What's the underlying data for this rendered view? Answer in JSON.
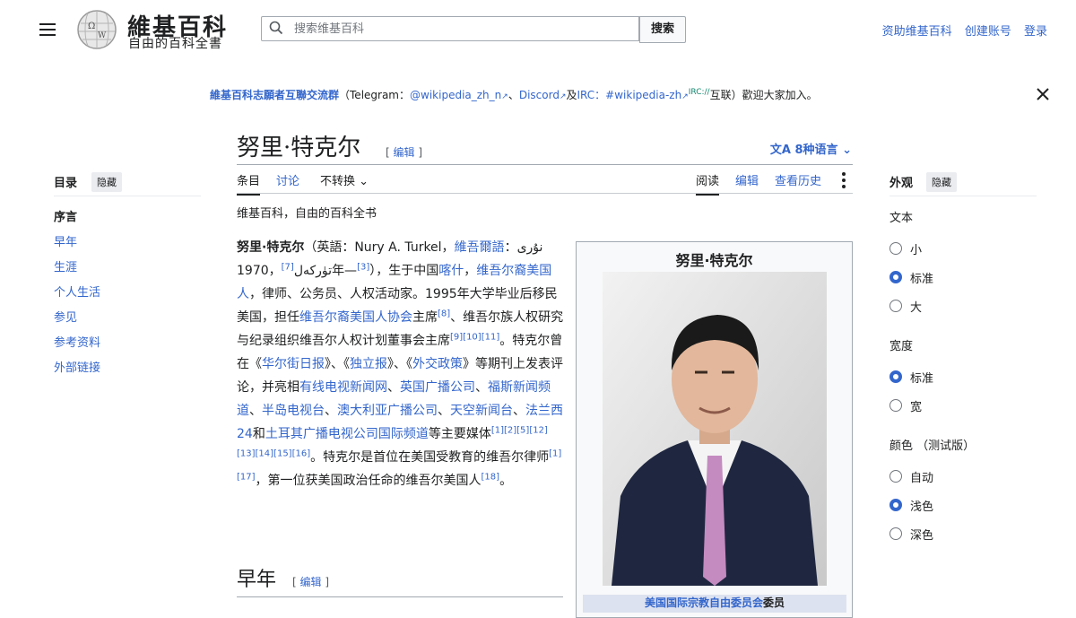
{
  "header": {
    "wordmark": "維基百科",
    "tagline": "自由的百科全書",
    "search_placeholder": "搜索维基百科",
    "search_button": "搜索",
    "links": [
      "资助维基百科",
      "创建账号",
      "登录"
    ]
  },
  "banner": {
    "title": "維基百科志願者互聯交流群",
    "p1": "（Telegram：",
    "telegram": "@wikipedia_zh_n",
    "sep": "、",
    "discord": "Discord",
    "and": "及",
    "irc": "IRC：",
    "irc_channel": "#wikipedia-zh",
    "irc_sup": "IRC://",
    "tail": "互联）歡迎大家加入。"
  },
  "article": {
    "title": "努里·特克尔",
    "edit": "编辑",
    "languages": "8种语言",
    "tabs_left": [
      "条目",
      "讨论",
      "不转换"
    ],
    "tabs_right": [
      "阅读",
      "编辑",
      "查看历史"
    ],
    "subtitle": "维基百科，自由的百科全书",
    "section": "早年"
  },
  "toc": {
    "title": "目录",
    "hide": "隐藏",
    "items": [
      "序言",
      "早年",
      "生涯",
      "个人生活",
      "参见",
      "参考资料",
      "外部链接"
    ]
  },
  "infobox": {
    "title": "努里·特克尔",
    "caption_link": "美国国际宗教自由委员会",
    "caption_tail": "委员"
  },
  "appearance": {
    "title": "外观",
    "hide": "隐藏",
    "groups": [
      {
        "label": "文本",
        "options": [
          "小",
          "标准",
          "大"
        ],
        "selected": 1
      },
      {
        "label": "宽度",
        "options": [
          "标准",
          "宽"
        ],
        "selected": 0
      },
      {
        "label": "颜色 （测试版）",
        "options": [
          "自动",
          "浅色",
          "深色"
        ],
        "selected": 1
      }
    ]
  },
  "body": {
    "b1": "努里·特克尔",
    "t1": "（英語：Nury A. Turkel，",
    "l1": "維吾爾語",
    "t2": "：نۇرى تۈركەل",
    "r7": "[7]",
    "t3": "，1970年—",
    "r3": "[3]",
    "t4": "），生于中国",
    "l2": "喀什",
    "t5": "，",
    "l3": "维吾尔裔美国人",
    "t6": "，律师、公务员、人权活动家。1995年大学毕业后移民美国，担任",
    "l4": "维吾尔裔美国人协会",
    "t7": "主席",
    "r8": "[8]",
    "t8": "、维吾尔族人权研究与纪录组织维吾尔人权计划董事会主席",
    "r9": "[9][10][11]",
    "t9": "。特克尔曾在《",
    "l5": "华尔街日报",
    "t10": "》、《",
    "l6": "独立报",
    "t11": "》、《",
    "l7": "外交政策",
    "t12": "》等期刊上发表评论，并亮相",
    "l8": "有线电视新闻网",
    "t13": "、",
    "l9": "英国广播公司",
    "t14": "、",
    "l10": "福斯新闻频道",
    "t15": "、",
    "l11": "半岛电视台",
    "t16": "、",
    "l12": "澳大利亚广播公司",
    "t17": "、",
    "l13": "天空新闻台",
    "t18": "、",
    "l14": "法兰西24",
    "t19": "和",
    "l15": "土耳其广播电视公司国际频道",
    "t20": "等主要媒体",
    "r1": "[1][2][5][12][13][14][15][16]",
    "t21": "。特克尔是首位在美国受教育的维吾尔律师",
    "r2": "[1][17]",
    "t22": "，第一位获美国政治任命的维吾尔美国人",
    "r18": "[18]",
    "t23": "。"
  }
}
